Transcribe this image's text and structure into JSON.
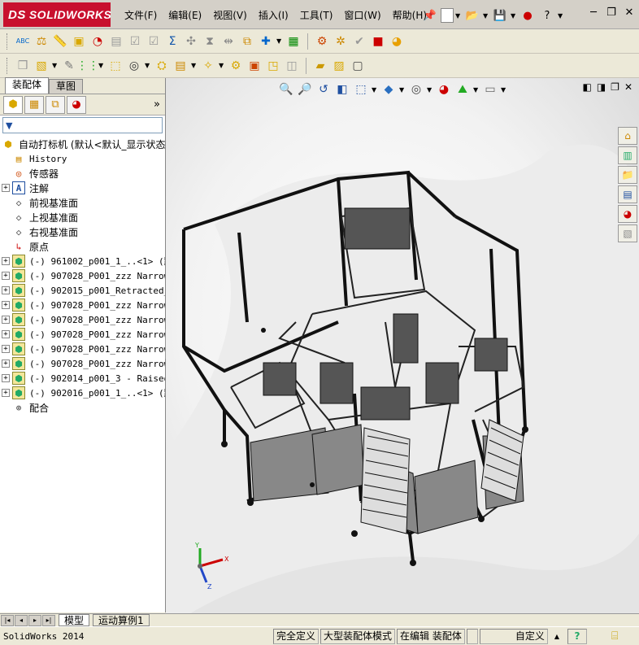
{
  "app": {
    "logo_prefix": "DS",
    "logo_text": "SOLIDWORKS"
  },
  "menu": [
    "文件(F)",
    "编辑(E)",
    "视图(V)",
    "插入(I)",
    "工具(T)",
    "窗口(W)",
    "帮助(H)"
  ],
  "window_controls": {
    "minimize": "─",
    "restore": "❐",
    "close": "✕"
  },
  "toolbar1_icons": [
    "abc-spell-icon",
    "balance-icon",
    "measure-icon",
    "library-icon",
    "gauge-icon",
    "part-icon",
    "check-icon",
    "check-icon-2",
    "sigma-icon",
    "tool-icon",
    "mass-icon",
    "interference-icon",
    "clearance-icon",
    "collision-icon",
    "table-icon",
    "sensor-icon",
    "rebuild-icon",
    "evaluate-icon",
    "assembly-icon",
    "appearance-icon"
  ],
  "toolbar2_icons": [
    "mate-icon",
    "insert-component-icon",
    "pencil-icon",
    "pattern-icon",
    "move-icon",
    "explode-icon",
    "smart-icon",
    "bom-icon",
    "gear-icon",
    "view-icon",
    "feature-icon",
    "linear-icon",
    "sketch-icon",
    "note-icon"
  ],
  "panel": {
    "tabs": [
      "装配体",
      "草图"
    ],
    "mgr_more": "»",
    "filter_icon": "▼",
    "root_label": "自动打标机  (默认<默认_显示状态",
    "tree": [
      {
        "type": "history",
        "label": "History",
        "font": "mono"
      },
      {
        "type": "sensor",
        "label": "传感器",
        "font": "cjk"
      },
      {
        "type": "annotation",
        "label": "注解",
        "font": "cjk",
        "expander": "+"
      },
      {
        "type": "plane",
        "label": "前视基准面",
        "font": "cjk"
      },
      {
        "type": "plane",
        "label": "上视基准面",
        "font": "cjk"
      },
      {
        "type": "plane",
        "label": "右视基准面",
        "font": "cjk"
      },
      {
        "type": "origin",
        "label": "原点",
        "font": "cjk"
      },
      {
        "type": "comp",
        "label": "(-) 961002_p001_1_..<1> (默认",
        "expander": "+"
      },
      {
        "type": "comp",
        "label": "(-) 907028_P001_zzz Narrow",
        "expander": "+"
      },
      {
        "type": "comp",
        "label": "(-) 902015_p001_Retracted_",
        "expander": "+"
      },
      {
        "type": "comp",
        "label": "(-) 907028_P001_zzz Narrow",
        "expander": "+"
      },
      {
        "type": "comp",
        "label": "(-) 907028_P001_zzz Narrow",
        "expander": "+"
      },
      {
        "type": "comp",
        "label": "(-) 907028_P001_zzz Narrow",
        "expander": "+"
      },
      {
        "type": "comp",
        "label": "(-) 907028_P001_zzz Narrow",
        "expander": "+"
      },
      {
        "type": "comp",
        "label": "(-) 907028_P001_zzz Narrow",
        "expander": "+"
      },
      {
        "type": "comp",
        "label": "(-) 902014_p001_3 - Raised",
        "expander": "+"
      },
      {
        "type": "comp",
        "label": "(-) 902016_p001_1_..<1> (默认",
        "expander": "+"
      },
      {
        "type": "mates",
        "label": "配合",
        "font": "cjk"
      }
    ]
  },
  "viewport": {
    "window_controls": [
      "◧",
      "◨",
      "❐",
      "✕"
    ],
    "triad": {
      "x": "X",
      "y": "Y",
      "z": "Z"
    }
  },
  "bottom_tabs": [
    "模型",
    "运动算例1"
  ],
  "status": {
    "app_version": "SolidWorks 2014",
    "fully_defined": "完全定义",
    "large_assembly": "大型装配体模式",
    "editing": "在编辑 装配体",
    "custom": "自定义",
    "help_icon": "?"
  },
  "colors": {
    "accent": "#c8102e",
    "chrome": "#ece9d8",
    "viewport_bg": "#ffffff"
  }
}
